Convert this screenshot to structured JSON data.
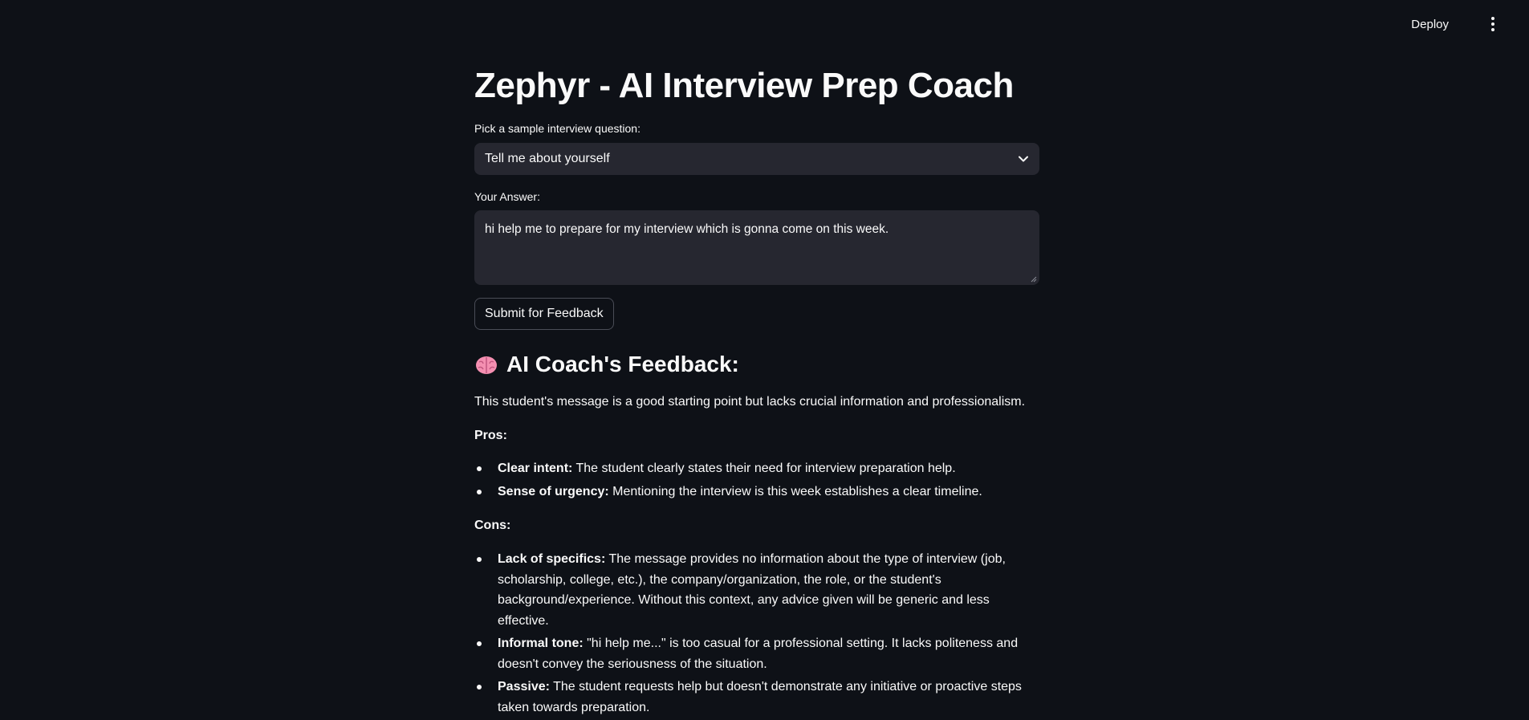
{
  "header": {
    "deploy_label": "Deploy",
    "menu_icon": "more-vertical-icon"
  },
  "main": {
    "title": "Zephyr - AI Interview Prep Coach",
    "question_select": {
      "label": "Pick a sample interview question:",
      "selected": "Tell me about yourself"
    },
    "answer": {
      "label": "Your Answer:",
      "value": "hi help me to prepare for my interview which is gonna come on this week."
    },
    "submit_label": "Submit for Feedback",
    "feedback": {
      "heading": "AI Coach's Feedback:",
      "heading_icon": "brain-icon",
      "intro": "This student's message is a good starting point but lacks crucial information and professionalism.",
      "pros_heading": "Pros:",
      "pros": [
        {
          "title": "Clear intent:",
          "text": " The student clearly states their need for interview preparation help."
        },
        {
          "title": "Sense of urgency:",
          "text": " Mentioning the interview is this week establishes a clear timeline."
        }
      ],
      "cons_heading": "Cons:",
      "cons": [
        {
          "title": "Lack of specifics:",
          "text": " The message provides no information about the type of interview (job, scholarship, college, etc.), the company/organization, the role, or the student's background/experience. Without this context, any advice given will be generic and less effective."
        },
        {
          "title": "Informal tone:",
          "text": " \"hi help me...\" is too casual for a professional setting. It lacks politeness and doesn't convey the seriousness of the situation."
        },
        {
          "title": "Passive:",
          "text": " The student requests help but doesn't demonstrate any initiative or proactive steps taken towards preparation."
        }
      ]
    }
  },
  "colors": {
    "background": "#0e1117",
    "input_bg": "#262730",
    "text": "#fafafa",
    "brain": "#f48fb1"
  }
}
